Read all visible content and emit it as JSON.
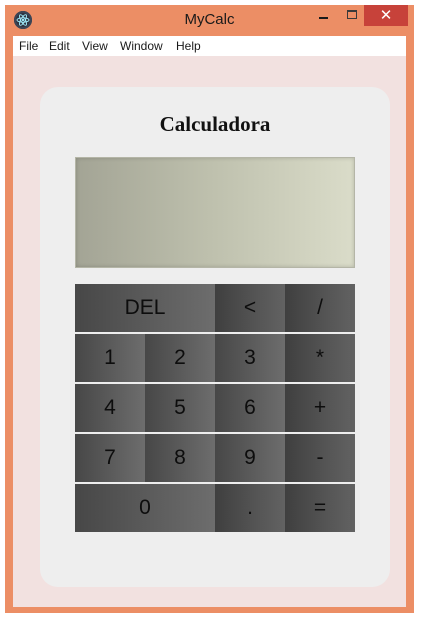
{
  "window": {
    "title": "MyCalc",
    "close_glyph": "✕",
    "icon": "electron-app-icon"
  },
  "menu": {
    "items": [
      {
        "label": "File"
      },
      {
        "label": "Edit"
      },
      {
        "label": "View"
      },
      {
        "label": "Window"
      },
      {
        "label": "Help"
      }
    ]
  },
  "calculator": {
    "title": "Calculadora",
    "display_value": "",
    "keys": {
      "del": "DEL",
      "back": "<",
      "divide": "/",
      "one": "1",
      "two": "2",
      "three": "3",
      "multiply": "*",
      "four": "4",
      "five": "5",
      "six": "6",
      "plus": "+",
      "seven": "7",
      "eight": "8",
      "nine": "9",
      "minus": "-",
      "zero": "0",
      "decimal": ".",
      "equals": "="
    }
  },
  "colors": {
    "window_frame": "#ec8e65",
    "close_button": "#c7423a",
    "client_background": "#f2e1e0",
    "card_background": "#eeeeee",
    "key_dark": "#474747",
    "key_light": "#6d6d6d"
  }
}
